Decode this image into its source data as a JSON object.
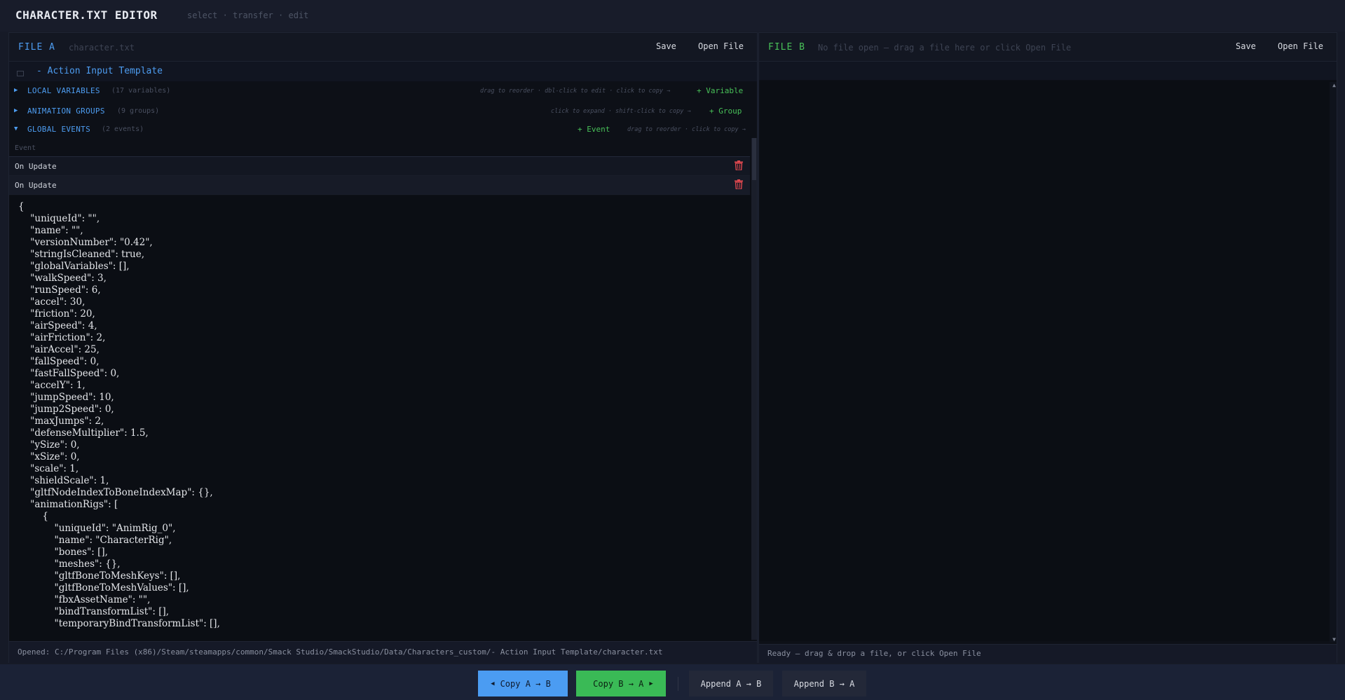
{
  "app": {
    "title": "CHARACTER.TXT EDITOR",
    "subtitle": "select · transfer · edit"
  },
  "file_a": {
    "label": "FILE A",
    "filename": "character.txt",
    "save": "Save",
    "open": "Open File",
    "template_title": "- Action Input Template",
    "sections": [
      {
        "title": "LOCAL VARIABLES",
        "count": "(17 variables)",
        "hint": "drag to reorder · dbl-click to edit · click to copy →",
        "add": "+ Variable"
      },
      {
        "title": "ANIMATION GROUPS",
        "count": "(9 groups)",
        "hint": "click to expand · shift-click to copy →",
        "add": "+ Group"
      },
      {
        "title": "GLOBAL EVENTS",
        "count": "(2 events)",
        "hint": "drag to reorder · click to copy →",
        "add": "+ Event"
      }
    ],
    "events_header": "Event",
    "events": [
      "On Update",
      "On Update"
    ],
    "json_text": "{\n    \"uniqueId\": \"\",\n    \"name\": \"\",\n    \"versionNumber\": \"0.42\",\n    \"stringIsCleaned\": true,\n    \"globalVariables\": [],\n    \"walkSpeed\": 3,\n    \"runSpeed\": 6,\n    \"accel\": 30,\n    \"friction\": 20,\n    \"airSpeed\": 4,\n    \"airFriction\": 2,\n    \"airAccel\": 25,\n    \"fallSpeed\": 0,\n    \"fastFallSpeed\": 0,\n    \"accelY\": 1,\n    \"jumpSpeed\": 10,\n    \"jump2Speed\": 0,\n    \"maxJumps\": 2,\n    \"defenseMultiplier\": 1.5,\n    \"ySize\": 0,\n    \"xSize\": 0,\n    \"scale\": 1,\n    \"shieldScale\": 1,\n    \"gltfNodeIndexToBoneIndexMap\": {},\n    \"animationRigs\": [\n        {\n            \"uniqueId\": \"AnimRig_0\",\n            \"name\": \"CharacterRig\",\n            \"bones\": [],\n            \"meshes\": {},\n            \"gltfBoneToMeshKeys\": [],\n            \"gltfBoneToMeshValues\": [],\n            \"fbxAssetName\": \"\",\n            \"bindTransformList\": [],\n            \"temporaryBindTransformList\": [],",
    "status": "Opened: C:/Program Files (x86)/Steam/steamapps/common/Smack Studio/SmackStudio/Data/Characters_custom/- Action Input Template/character.txt"
  },
  "file_b": {
    "label": "FILE B",
    "placeholder": "No file open  —  drag a file here or click Open File",
    "save": "Save",
    "open": "Open File",
    "status": "Ready  —  drag & drop a file, or click Open File"
  },
  "footer": {
    "copy_a_b": "Copy A → B",
    "copy_b_a": "Copy B → A",
    "append_a_b": "Append A → B",
    "append_b_a": "Append B → A"
  },
  "colors": {
    "accent_blue": "#4b9cf2",
    "accent_green": "#3aba56",
    "delete_red": "#e0484f"
  },
  "icons": [
    "trash-icon",
    "triangle-right-icon",
    "triangle-down-icon",
    "arrow-left-icon",
    "arrow-right-icon"
  ]
}
